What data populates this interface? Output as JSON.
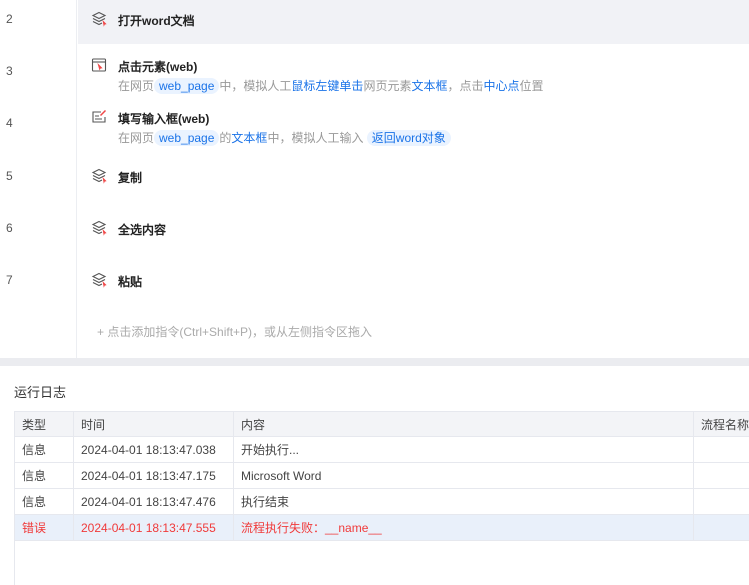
{
  "steps": [
    {
      "num": "2",
      "title": "打开word文档",
      "icon": "layers-icon",
      "active": true
    },
    {
      "num": "3",
      "title": "点击元素(web)",
      "icon": "click-element-icon",
      "desc": [
        [
          "在网页",
          ""
        ],
        [
          "web_page",
          "chip"
        ],
        [
          "中，模拟人工",
          ""
        ],
        [
          "鼠标左键单击",
          "hl"
        ],
        [
          "网页元素",
          ""
        ],
        [
          "文本框",
          "hl"
        ],
        [
          "，点击",
          ""
        ],
        [
          "中心点",
          "hl"
        ],
        [
          "位置",
          ""
        ]
      ]
    },
    {
      "num": "4",
      "title": "填写输入框(web)",
      "icon": "edit-input-icon",
      "desc": [
        [
          "在网页",
          ""
        ],
        [
          "web_page",
          "chip"
        ],
        [
          "的",
          ""
        ],
        [
          "文本框",
          "hl"
        ],
        [
          "中，模拟人工输入 ",
          ""
        ],
        [
          "返回word对象",
          "chip"
        ]
      ]
    },
    {
      "num": "5",
      "title": "复制",
      "icon": "layers-icon"
    },
    {
      "num": "6",
      "title": "全选内容",
      "icon": "layers-icon"
    },
    {
      "num": "7",
      "title": "粘贴",
      "icon": "layers-icon"
    }
  ],
  "add_hint": "点击添加指令(Ctrl+Shift+P)，或从左侧指令区拖入",
  "log": {
    "title": "运行日志",
    "columns": [
      "类型",
      "时间",
      "内容",
      "流程名称"
    ],
    "rows": [
      {
        "type": "信息",
        "time": "2024-04-01 18:13:47.038",
        "content": "开始执行...",
        "flow": ""
      },
      {
        "type": "信息",
        "time": "2024-04-01 18:13:47.175",
        "content": "Microsoft Word",
        "flow": ""
      },
      {
        "type": "信息",
        "time": "2024-04-01 18:13:47.476",
        "content": "执行结束",
        "flow": ""
      },
      {
        "type": "错误",
        "time": "2024-04-01 18:13:47.555",
        "content": "流程执行失败：__name__",
        "flow": "",
        "error": true
      }
    ]
  },
  "colors": {
    "accent": "#1a73e8",
    "error": "#f03a3a"
  }
}
